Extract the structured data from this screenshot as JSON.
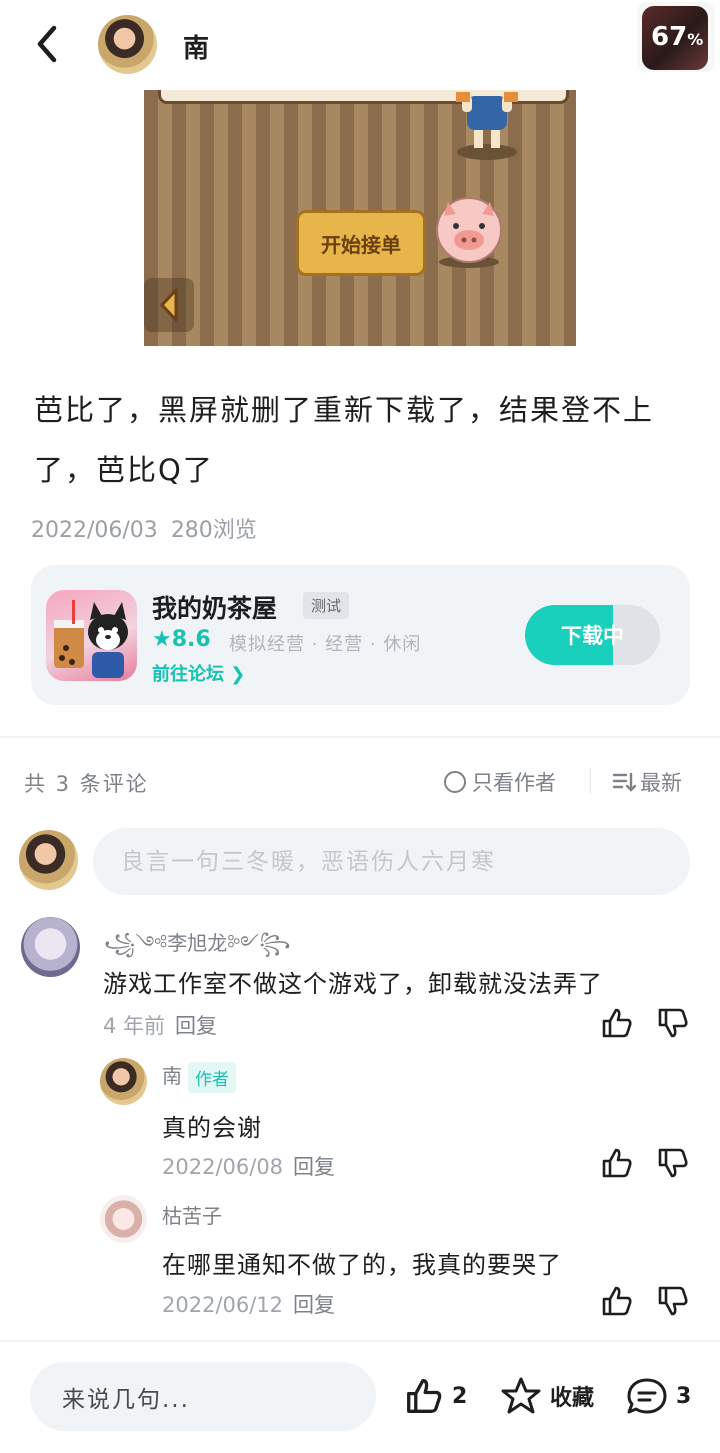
{
  "header": {
    "author_name": "南",
    "badge_percent": "67",
    "badge_unit": "%",
    "icons": [
      "back-arrow-icon",
      "avatar",
      "game-progress-badge"
    ]
  },
  "screenshot": {
    "start_button": "开始接单"
  },
  "post": {
    "text": "芭比了，黑屏就删了重新下载了，结果登不上了，芭比Q了",
    "date": "2022/06/03",
    "views": "280浏览"
  },
  "game_card": {
    "name": "我的奶茶屋",
    "tag": "测试",
    "rating": "8.6",
    "categories": "模拟经营 · 经营 · 休闲",
    "forum_link": "前往论坛",
    "download_label": "下载中",
    "download_progress": 0.65,
    "accent_color": "#19d0bd"
  },
  "comments_header": {
    "count_text": "共 3 条评论",
    "author_only": "只看作者",
    "sort": "最新"
  },
  "comment_input": {
    "placeholder": "良言一句三冬暖，恶语伤人六月寒"
  },
  "comments": [
    {
      "name": "꧁༺李旭龙༻꧂",
      "text": "游戏工作室不做这个游戏了，卸载就没法弄了",
      "time": "4 年前",
      "reply": "回复"
    }
  ],
  "replies": [
    {
      "name": "南",
      "badge": "作者",
      "text": "真的会谢",
      "time": "2022/06/08",
      "reply": "回复"
    },
    {
      "name": "枯苦子",
      "text": "在哪里通知不做了的，我真的要哭了",
      "time": "2022/06/12",
      "reply": "回复"
    }
  ],
  "bottom_bar": {
    "input_placeholder": "来说几句...",
    "likes": "2",
    "favorite": "收藏",
    "comments": "3"
  }
}
